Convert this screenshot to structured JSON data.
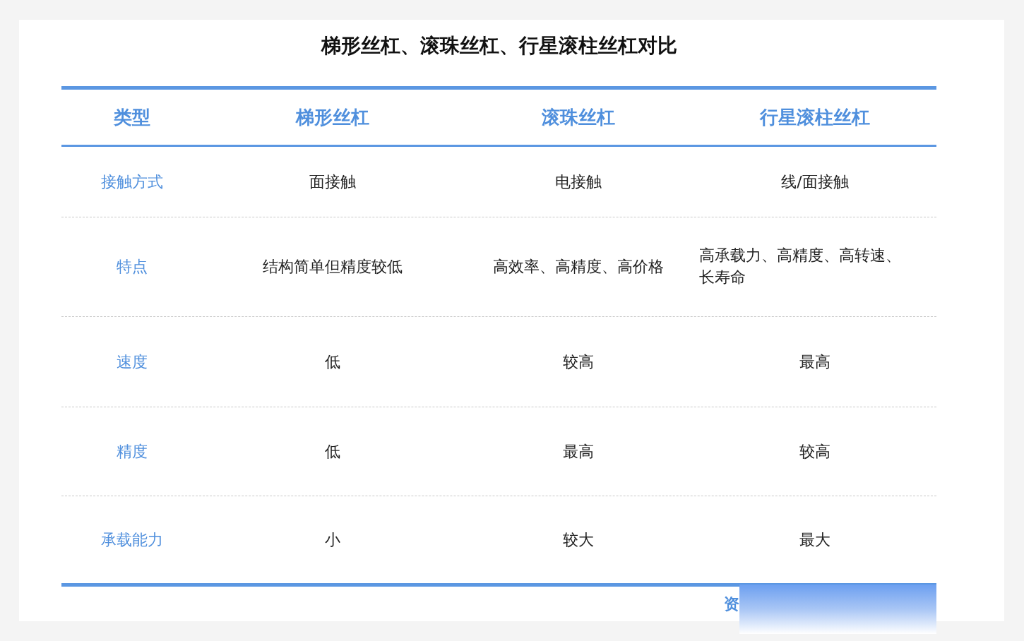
{
  "title": "梯形丝杠、滚珠丝杠、行星滚柱丝杠对比",
  "table": {
    "columns": [
      "类型",
      "梯形丝杠",
      "滚珠丝杠",
      "行星滚柱丝杠"
    ],
    "rows": [
      [
        "接触方式",
        "面接触",
        "电接触",
        "线/面接触"
      ],
      [
        "特点",
        "结构简单但精度较低",
        "高效率、高精度、高价格",
        "高承载力、高精度、高转速、长寿命"
      ],
      [
        "速度",
        "低",
        "较高",
        "最高"
      ],
      [
        "精度",
        "低",
        "最高",
        "较高"
      ],
      [
        "承载能力",
        "小",
        "较大",
        "最大"
      ]
    ]
  },
  "source_note": "资"
}
